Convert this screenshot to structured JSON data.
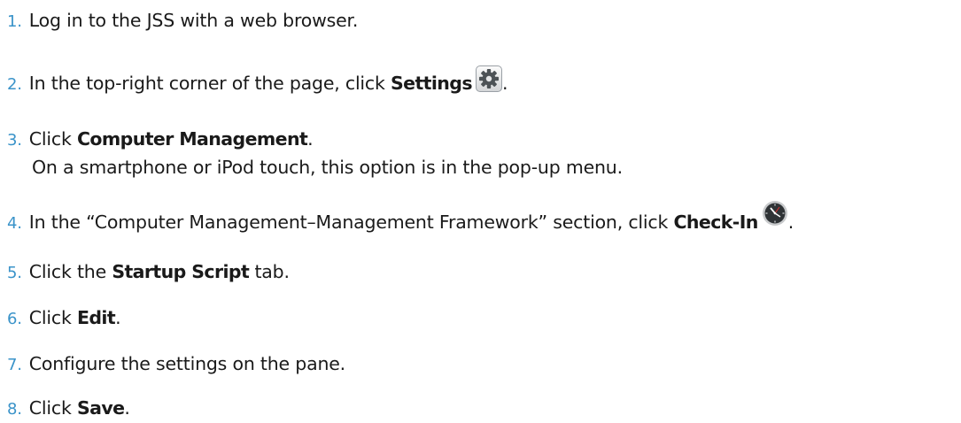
{
  "steps": [
    {
      "num": "1.",
      "t1": "Log in to the JSS with a web browser."
    },
    {
      "num": "2.",
      "t1": "In the top-right corner of the page, click ",
      "bold": "Settings",
      "after": "."
    },
    {
      "num": "3.",
      "t1": "Click ",
      "bold": "Computer Management",
      "after": ".",
      "sub": "On a smartphone or iPod touch, this option is in the pop-up menu."
    },
    {
      "num": "4.",
      "t1": "In the “Computer Management–Management Framework” section, click ",
      "bold": "Check-In",
      "after": "."
    },
    {
      "num": "5.",
      "t1": "Click the ",
      "bold": "Startup Script",
      "after": " tab."
    },
    {
      "num": "6.",
      "t1": "Click ",
      "bold": "Edit",
      "after": "."
    },
    {
      "num": "7.",
      "t1": "Configure the settings on the pane."
    },
    {
      "num": "8.",
      "t1": "Click ",
      "bold": "Save",
      "after": "."
    }
  ],
  "icons": {
    "settings": "gear-icon",
    "check_in": "clock-icon"
  }
}
